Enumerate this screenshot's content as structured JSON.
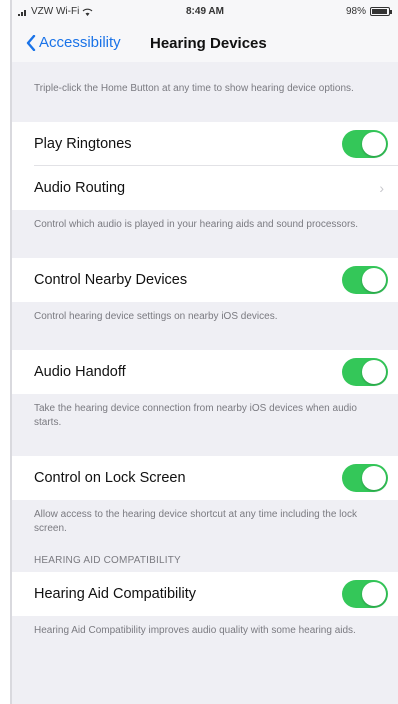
{
  "status_bar": {
    "carrier": "VZW Wi-Fi",
    "time": "8:49 AM",
    "battery": "98%"
  },
  "nav": {
    "back_label": "Accessibility",
    "title": "Hearing Devices"
  },
  "top_footer": "Triple-click the Home Button at any time to show hearing device options.",
  "rows": {
    "play_ringtones": {
      "label": "Play Ringtones",
      "on": true
    },
    "audio_routing": {
      "label": "Audio Routing"
    },
    "control_nearby": {
      "label": "Control Nearby Devices",
      "on": true
    },
    "audio_handoff": {
      "label": "Audio Handoff",
      "on": true
    },
    "lock_screen": {
      "label": "Control on Lock Screen",
      "on": true
    },
    "hac": {
      "label": "Hearing Aid Compatibility",
      "on": true
    }
  },
  "footers": {
    "audio_routing": "Control which audio is played in your hearing aids and sound processors.",
    "control_nearby": "Control hearing device settings on nearby iOS devices.",
    "audio_handoff": "Take the hearing device connection from nearby iOS devices when audio starts.",
    "lock_screen": "Allow access to the hearing device shortcut at any time including the lock screen.",
    "hac": "Hearing Aid Compatibility improves audio quality with some hearing aids."
  },
  "section_headers": {
    "hac": "HEARING AID COMPATIBILITY"
  },
  "colors": {
    "accent": "#1a73e8",
    "toggle_on": "#34c759",
    "background": "#efeff4"
  }
}
